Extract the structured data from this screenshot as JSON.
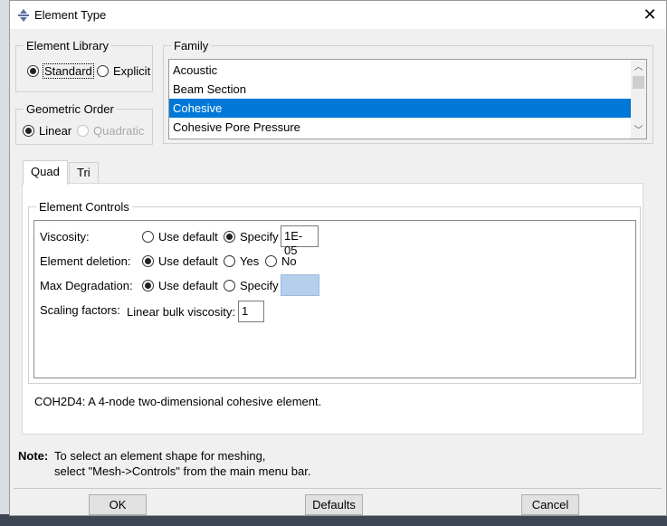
{
  "window": {
    "title": "Element Type",
    "close_label": "✕"
  },
  "element_library": {
    "legend": "Element Library",
    "options": [
      {
        "label": "Standard",
        "selected": true
      },
      {
        "label": "Explicit",
        "selected": false
      }
    ]
  },
  "geometric_order": {
    "legend": "Geometric Order",
    "options": [
      {
        "label": "Linear",
        "selected": true,
        "enabled": true
      },
      {
        "label": "Quadratic",
        "selected": false,
        "enabled": false
      }
    ]
  },
  "family": {
    "legend": "Family",
    "items": [
      "Acoustic",
      "Beam Section",
      "Cohesive",
      "Cohesive Pore Pressure"
    ],
    "selected_index": 2
  },
  "tabs": [
    {
      "label": "Quad",
      "active": true
    },
    {
      "label": "Tri",
      "active": false
    }
  ],
  "element_controls": {
    "legend": "Element Controls",
    "viscosity": {
      "label": "Viscosity:",
      "use_default": "Use default",
      "specify": "Specify",
      "value": "1E-05",
      "selected": "specify"
    },
    "element_deletion": {
      "label": "Element deletion:",
      "use_default": "Use default",
      "yes": "Yes",
      "no": "No",
      "selected": "use_default"
    },
    "max_degradation": {
      "label": "Max Degradation:",
      "use_default": "Use default",
      "specify": "Specify",
      "value": "",
      "selected": "use_default"
    },
    "scaling_factors": {
      "label": "Scaling factors:",
      "linear_bulk_label": "Linear bulk viscosity:",
      "linear_bulk_value": "1"
    }
  },
  "description": "COH2D4:  A 4-node two-dimensional cohesive element.",
  "note": {
    "label": "Note:",
    "line1": "To select an element shape for meshing,",
    "line2": "select \"Mesh->Controls\" from the main menu bar."
  },
  "buttons": {
    "ok": "OK",
    "defaults": "Defaults",
    "cancel": "Cancel"
  },
  "colors": {
    "selection": "#0078d7",
    "disabled_field": "#b5cfed"
  }
}
